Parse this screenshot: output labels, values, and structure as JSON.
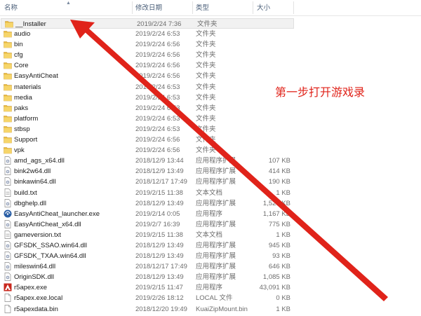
{
  "columns": {
    "name": "名称",
    "date": "修改日期",
    "type": "类型",
    "size": "大小"
  },
  "annotation": "第一步打开游戏录",
  "accent_color": "#e0231a",
  "rows": [
    {
      "name": "__Installer",
      "date": "2019/2/24 7:36",
      "type": "文件夹",
      "size": "",
      "icon": "folder-icon",
      "selected": true
    },
    {
      "name": "audio",
      "date": "2019/2/24 6:53",
      "type": "文件夹",
      "size": "",
      "icon": "folder-icon"
    },
    {
      "name": "bin",
      "date": "2019/2/24 6:56",
      "type": "文件夹",
      "size": "",
      "icon": "folder-icon"
    },
    {
      "name": "cfg",
      "date": "2019/2/24 6:56",
      "type": "文件夹",
      "size": "",
      "icon": "folder-icon"
    },
    {
      "name": "Core",
      "date": "2019/2/24 6:56",
      "type": "文件夹",
      "size": "",
      "icon": "folder-icon"
    },
    {
      "name": "EasyAntiCheat",
      "date": "2019/2/24 6:56",
      "type": "文件夹",
      "size": "",
      "icon": "folder-icon"
    },
    {
      "name": "materials",
      "date": "2019/2/24 6:53",
      "type": "文件夹",
      "size": "",
      "icon": "folder-icon"
    },
    {
      "name": "media",
      "date": "2019/2/24 6:53",
      "type": "文件夹",
      "size": "",
      "icon": "folder-icon"
    },
    {
      "name": "paks",
      "date": "2019/2/24 6:53",
      "type": "文件夹",
      "size": "",
      "icon": "folder-icon"
    },
    {
      "name": "platform",
      "date": "2019/2/24 6:53",
      "type": "文件夹",
      "size": "",
      "icon": "folder-icon"
    },
    {
      "name": "stbsp",
      "date": "2019/2/24 6:53",
      "type": "文件夹",
      "size": "",
      "icon": "folder-icon"
    },
    {
      "name": "Support",
      "date": "2019/2/24 6:56",
      "type": "文件夹",
      "size": "",
      "icon": "folder-icon"
    },
    {
      "name": "vpk",
      "date": "2019/2/24 6:56",
      "type": "文件夹",
      "size": "",
      "icon": "folder-icon"
    },
    {
      "name": "amd_ags_x64.dll",
      "date": "2018/12/9 13:44",
      "type": "应用程序扩展",
      "size": "107 KB",
      "icon": "dll-icon"
    },
    {
      "name": "bink2w64.dll",
      "date": "2018/12/9 13:49",
      "type": "应用程序扩展",
      "size": "414 KB",
      "icon": "dll-icon"
    },
    {
      "name": "binkawin64.dll",
      "date": "2018/12/17 17:49",
      "type": "应用程序扩展",
      "size": "190 KB",
      "icon": "dll-icon"
    },
    {
      "name": "build.txt",
      "date": "2019/2/15 11:38",
      "type": "文本文档",
      "size": "1 KB",
      "icon": "text-file-icon"
    },
    {
      "name": "dbghelp.dll",
      "date": "2018/12/9 13:49",
      "type": "应用程序扩展",
      "size": "1,523 KB",
      "icon": "dll-icon"
    },
    {
      "name": "EasyAntiCheat_launcher.exe",
      "date": "2019/2/14 0:05",
      "type": "应用程序",
      "size": "1,167 KB",
      "icon": "eac-app-icon"
    },
    {
      "name": "EasyAntiCheat_x64.dll",
      "date": "2019/2/7 16:39",
      "type": "应用程序扩展",
      "size": "775 KB",
      "icon": "dll-icon"
    },
    {
      "name": "gameversion.txt",
      "date": "2019/2/15 11:38",
      "type": "文本文档",
      "size": "1 KB",
      "icon": "text-file-icon"
    },
    {
      "name": "GFSDK_SSAO.win64.dll",
      "date": "2018/12/9 13:49",
      "type": "应用程序扩展",
      "size": "945 KB",
      "icon": "dll-icon"
    },
    {
      "name": "GFSDK_TXAA.win64.dll",
      "date": "2018/12/9 13:49",
      "type": "应用程序扩展",
      "size": "93 KB",
      "icon": "dll-icon"
    },
    {
      "name": "mileswin64.dll",
      "date": "2018/12/17 17:49",
      "type": "应用程序扩展",
      "size": "646 KB",
      "icon": "dll-icon"
    },
    {
      "name": "OriginSDK.dll",
      "date": "2018/12/9 13:49",
      "type": "应用程序扩展",
      "size": "1,085 KB",
      "icon": "dll-icon"
    },
    {
      "name": "r5apex.exe",
      "date": "2019/2/15 11:47",
      "type": "应用程序",
      "size": "43,091 KB",
      "icon": "apex-app-icon"
    },
    {
      "name": "r5apex.exe.local",
      "date": "2019/2/26 18:12",
      "type": "LOCAL 文件",
      "size": "0 KB",
      "icon": "blank-file-icon"
    },
    {
      "name": "r5apexdata.bin",
      "date": "2018/12/20 19:49",
      "type": "KuaiZipMount.bin",
      "size": "1 KB",
      "icon": "blank-file-icon"
    }
  ]
}
